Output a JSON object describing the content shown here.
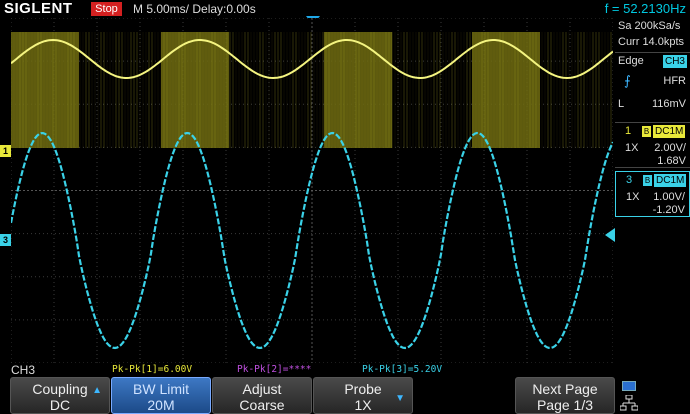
{
  "topbar": {
    "brand": "SIGLENT",
    "run_state": "Stop",
    "timebase": "M 5.00ms/ Delay:0.00s",
    "frequency": "f = 52.2130Hz"
  },
  "right_panel": {
    "sample_rate": "Sa 200kSa/s",
    "memory": "Curr 14.0kpts",
    "trigger_type": "Edge",
    "trigger_source": "CH3",
    "trigger_mode": "HFR",
    "level_label": "L",
    "level_value": "116mV",
    "channels": [
      {
        "num": "1",
        "coupling": "DC1M",
        "probe": "1X",
        "scale": "2.00V/",
        "offset": "1.68V",
        "color": "#e8e83a"
      },
      {
        "num": "3",
        "coupling": "DC1M",
        "probe": "1X",
        "scale": "1.00V/",
        "offset": "-1.20V",
        "color": "#3ad2e8"
      }
    ]
  },
  "measure": {
    "source": "CH3",
    "m1": "Pk-Pk[1]=6.00V",
    "m2": "Pk-Pk[2]=****",
    "m3": "Pk-Pk[3]=5.20V"
  },
  "softkeys": [
    {
      "line1": "Coupling",
      "line2": "DC"
    },
    {
      "line1": "BW Limit",
      "line2": "20M"
    },
    {
      "line1": "Adjust",
      "line2": "Coarse"
    },
    {
      "line1": "Probe",
      "line2": "1X"
    },
    {
      "line1": "Next Page",
      "line2": "Page 1/3"
    }
  ],
  "markers": {
    "ch1": "1",
    "ch3": "3"
  },
  "colors": {
    "ch1": "#e8e83a",
    "ch3": "#3ad2e8",
    "ch2_measure": "#c050e0",
    "trigger": "#1ea8e8"
  }
}
